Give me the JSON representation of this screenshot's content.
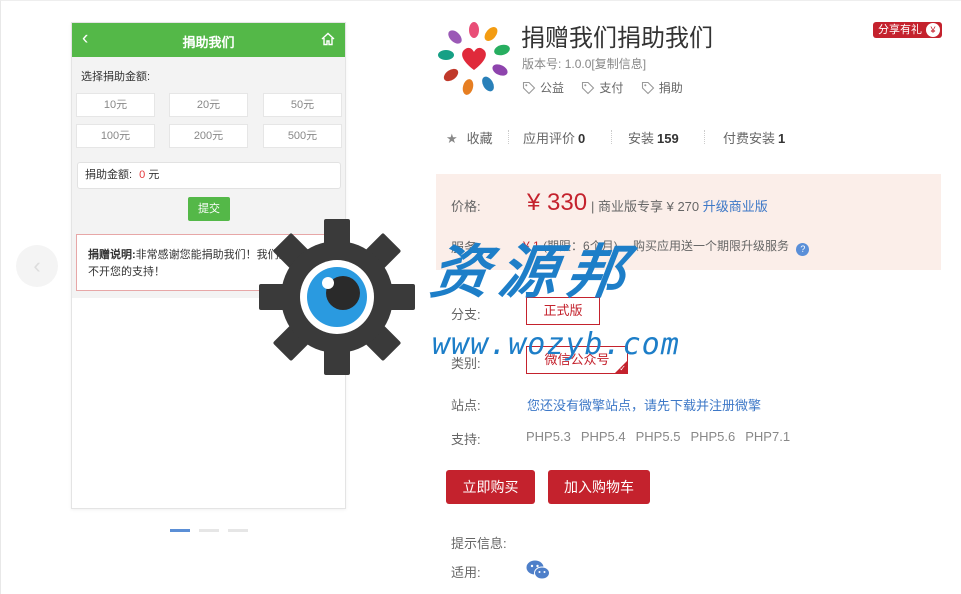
{
  "preview": {
    "header_title": "捐助我们",
    "choose_label": "选择捐助金额:",
    "amounts": [
      "10元",
      "20元",
      "50元",
      "100元",
      "200元",
      "500元"
    ],
    "amount_label": "捐助金额:",
    "amount_value": "0",
    "amount_unit": "元",
    "submit_label": "提交",
    "desc_bold": "捐赠说明:",
    "desc_text": "非常感谢您能捐助我们！我们的发展离不开您的支持！",
    "icons": [
      "back-arrow-icon",
      "home-icon"
    ],
    "slides_total": 3,
    "slide_active": 1
  },
  "watermark": {
    "text": "资源邦",
    "url": "www.wozyb.com"
  },
  "app": {
    "title": "捐赠我们捐助我们",
    "share_badge": "分享有礼",
    "version_label": "版本号:",
    "version_value": "1.0.0",
    "copy_link": "[复制信息]",
    "tags": [
      "公益",
      "支付",
      "捐助"
    ]
  },
  "stats": {
    "favorite": "收藏",
    "review_label": "应用评价",
    "review_count": "0",
    "install_label": "安装",
    "install_count": "159",
    "paid_label": "付费安装",
    "paid_count": "1"
  },
  "pricing": {
    "price_label": "价格:",
    "price": "¥ 330",
    "business_text": "| 商业版专享 ¥ 270",
    "upgrade_link": "升级商业版",
    "service_label": "服务:",
    "service_price": "¥ 1",
    "service_period": "(期限：6个月)",
    "service_desc": "购买应用送一个期限升级服务"
  },
  "options": {
    "branch_label": "分支:",
    "branch_value": "正式版",
    "category_label": "类别:",
    "category_value": "微信公众号",
    "site_label": "站点:",
    "site_text": "您还没有微擎站点，请先下载并注册微擎",
    "support_label": "支持:",
    "support_versions": [
      "PHP5.3",
      "PHP5.4",
      "PHP5.5",
      "PHP5.6",
      "PHP7.1"
    ]
  },
  "actions": {
    "buy_now": "立即购买",
    "add_cart": "加入购物车"
  },
  "footer": {
    "tips_label": "提示信息:",
    "apply_label": "适用:"
  },
  "colors": {
    "brand_red": "#c4222d",
    "green": "#54b848",
    "link_blue": "#3d78c7",
    "watermark_blue": "#1d7ec8"
  }
}
